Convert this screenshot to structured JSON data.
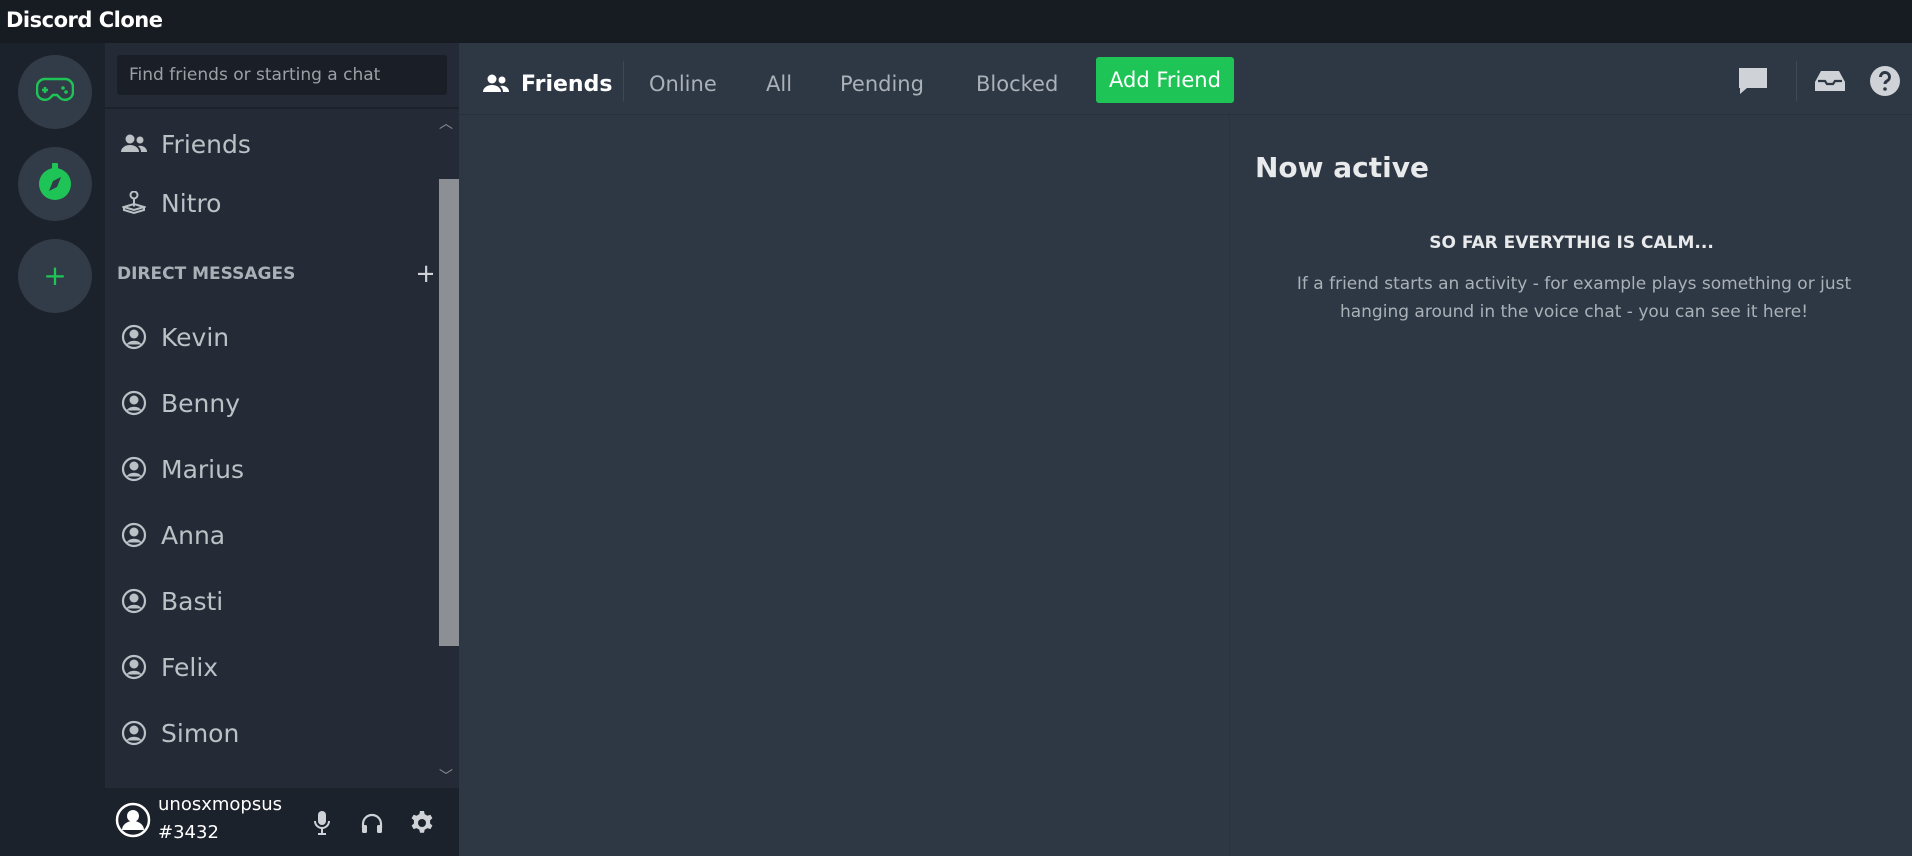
{
  "app": {
    "title": "Discord Clone"
  },
  "servers": [
    {
      "name": "gamepad-icon"
    },
    {
      "name": "compass-icon"
    },
    {
      "name": "plus-icon",
      "label": "+"
    }
  ],
  "sidebar": {
    "search_placeholder": "Find friends or starting a chat",
    "nav": [
      {
        "label": "Friends",
        "icon": "friends-icon"
      },
      {
        "label": "Nitro",
        "icon": "joystick-icon"
      }
    ],
    "dm_header": "DIRECT MESSAGES",
    "dm_add": "+",
    "dms": [
      "Kevin",
      "Benny",
      "Marius",
      "Anna",
      "Basti",
      "Felix",
      "Simon"
    ]
  },
  "user": {
    "name": "unosxmopsus",
    "tag": "#3432"
  },
  "topbar": {
    "title": "Friends",
    "tabs": [
      "Online",
      "All",
      "Pending",
      "Blocked"
    ],
    "add_friend": "Add Friend"
  },
  "active_now": {
    "heading": "Now active",
    "empty_title": "SO FAR EVERYTHIG IS CALM...",
    "empty_text": "If a friend starts an activity - for example plays something or just hanging around in the voice chat - you can see it here!"
  },
  "colors": {
    "accent": "#1ec556",
    "background": "#2e3744",
    "sidebar": "#242b36",
    "titlebar": "#171b22"
  }
}
